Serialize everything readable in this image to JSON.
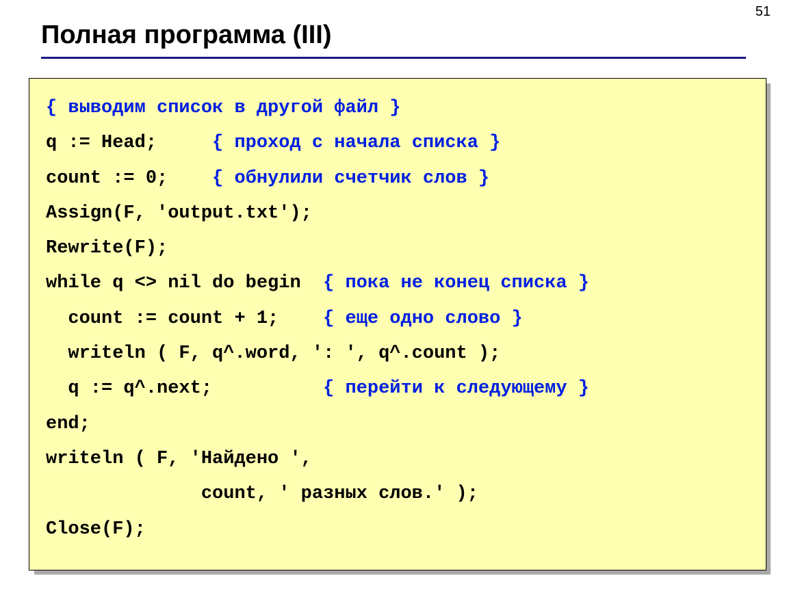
{
  "page_number": "51",
  "title": "Полная программа (III)",
  "code": {
    "l1a": "{ выводим список в другой файл }",
    "l2a": "q := Head;     ",
    "l2b": "{ проход с начала списка }",
    "l3a": "count := 0;    ",
    "l3b": "{ обнулили счетчик слов }",
    "l4": "Assign(F, 'output.txt');",
    "l5": "Rewrite(F);",
    "l6a": "while q <> nil do begin  ",
    "l6b": "{ пока не конец списка }",
    "l7a": "  count := count + 1;    ",
    "l7b": "{ еще одно слово }",
    "l8": "  writeln ( F, q^.word, ': ', q^.count );",
    "l9a": "  q := q^.next;          ",
    "l9b": "{ перейти к следующему }",
    "l10": "end;",
    "l11": "writeln ( F, 'Найдено ',",
    "l12": "              count, ' разных слов.' );",
    "l13": "Close(F);"
  }
}
